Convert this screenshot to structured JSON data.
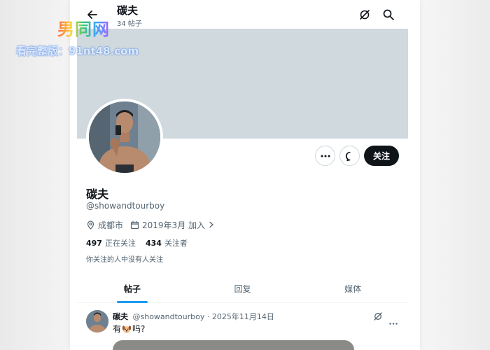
{
  "header": {
    "title": "碳夫",
    "post_count": "34 帖子"
  },
  "profile": {
    "name": "碳夫",
    "handle": "@showandtourboy",
    "location": "成都市",
    "joined": "2019年3月 加入",
    "following_count": "497",
    "following_label": "正在关注",
    "followers_count": "434",
    "followers_label": "关注者",
    "mutual_note": "你关注的人中没有人关注",
    "follow_button": "关注",
    "banner_color": "#cfd9de"
  },
  "tabs": [
    {
      "label": "帖子",
      "active": true
    },
    {
      "label": "回复",
      "active": false
    },
    {
      "label": "媒体",
      "active": false
    }
  ],
  "post": {
    "author": "碳夫",
    "handle_date": "@showandtourboy · 2025年11月14日",
    "text_before": "有",
    "emoji": "dog-emoji",
    "text_after": "吗?"
  },
  "icons": {
    "back": "arrow-left-icon",
    "top_grok": "grok-icon",
    "search": "search-icon",
    "more": "more-icon",
    "message": "message-icon",
    "location": "location-pin-icon",
    "calendar": "calendar-icon"
  },
  "watermark": {
    "logo": "男同网",
    "url_text": "看完整版：91nt48.com"
  },
  "colors": {
    "accent": "#1d9bf0",
    "text_primary": "#0f1419",
    "text_secondary": "#536471"
  }
}
